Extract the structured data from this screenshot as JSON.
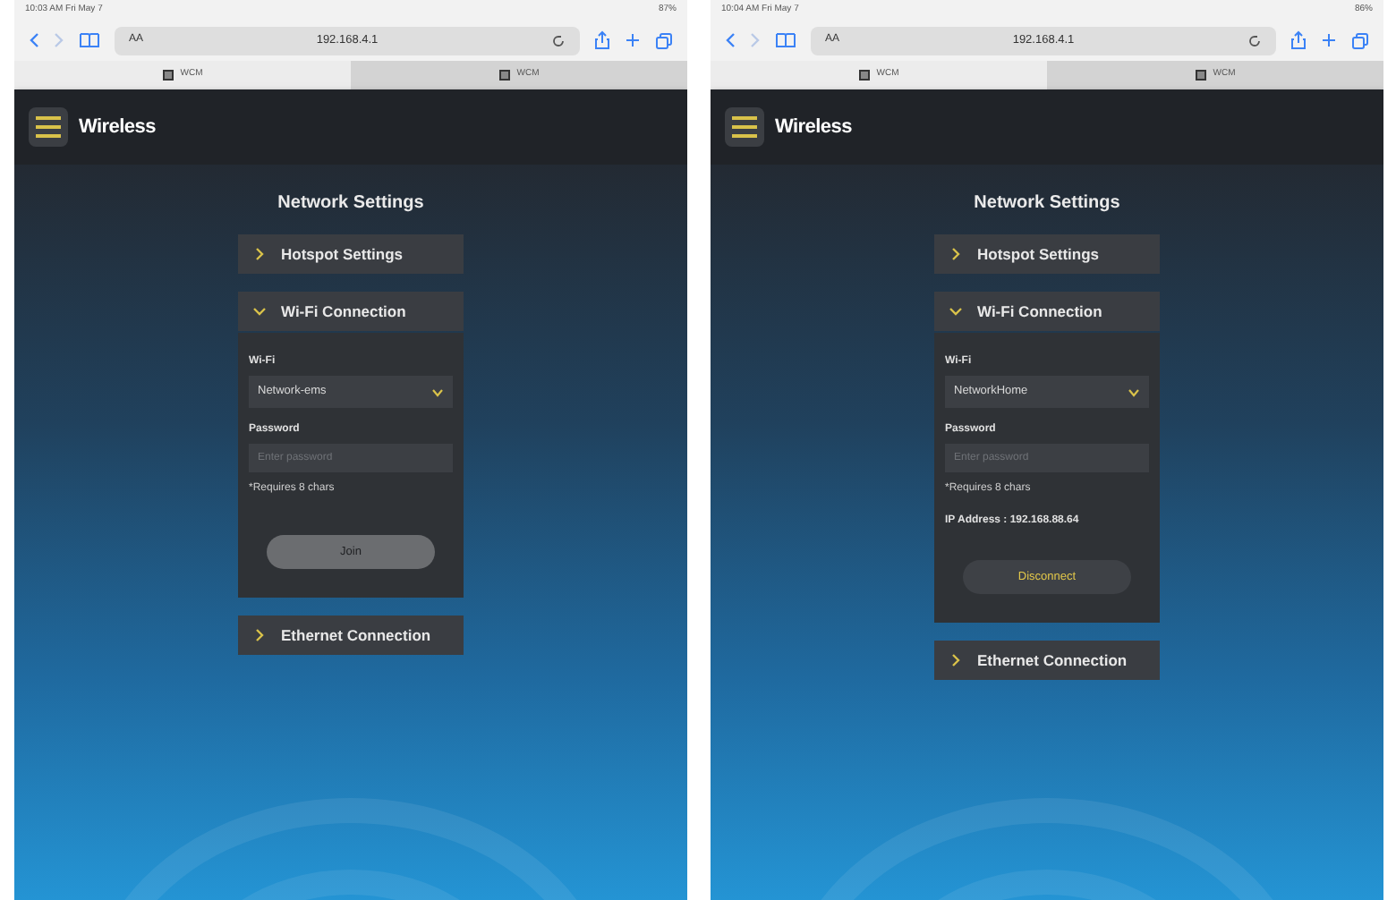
{
  "screens": [
    {
      "status_bar": {
        "time": "10:03 AM  Fri May 7",
        "battery": "87%"
      },
      "browser": {
        "text_size": "AA",
        "url": "192.168.4.1",
        "tabs": [
          {
            "label": "WCM",
            "selected": true
          },
          {
            "label": "WCM",
            "selected": false
          }
        ]
      },
      "app": {
        "logo": "Wireless",
        "title": "Network Settings",
        "sections": [
          {
            "title": "Hotspot Settings",
            "expanded": false
          },
          {
            "title": "Wi-Fi Connection",
            "expanded": true,
            "wifi_label": "Wi-Fi",
            "network": "Network-ems",
            "password_label": "Password",
            "password_placeholder": "Enter password",
            "hint": "*Requires 8 chars",
            "button": {
              "label": "Join",
              "kind": "join"
            }
          },
          {
            "title": "Ethernet Connection",
            "expanded": false
          }
        ]
      }
    },
    {
      "status_bar": {
        "time": "10:04 AM  Fri May 7",
        "battery": "86%"
      },
      "browser": {
        "text_size": "AA",
        "url": "192.168.4.1",
        "tabs": [
          {
            "label": "WCM",
            "selected": true
          },
          {
            "label": "WCM",
            "selected": false
          }
        ]
      },
      "app": {
        "logo": "Wireless",
        "title": "Network Settings",
        "sections": [
          {
            "title": "Hotspot Settings",
            "expanded": false
          },
          {
            "title": "Wi-Fi Connection",
            "expanded": true,
            "wifi_label": "Wi-Fi",
            "network": "NetworkHome",
            "password_label": "Password",
            "password_placeholder": "Enter password",
            "hint": "*Requires 8 chars",
            "ip": "IP Address : 192.168.88.64",
            "button": {
              "label": "Disconnect",
              "kind": "disconnect"
            }
          },
          {
            "title": "Ethernet Connection",
            "expanded": false
          }
        ]
      }
    }
  ]
}
